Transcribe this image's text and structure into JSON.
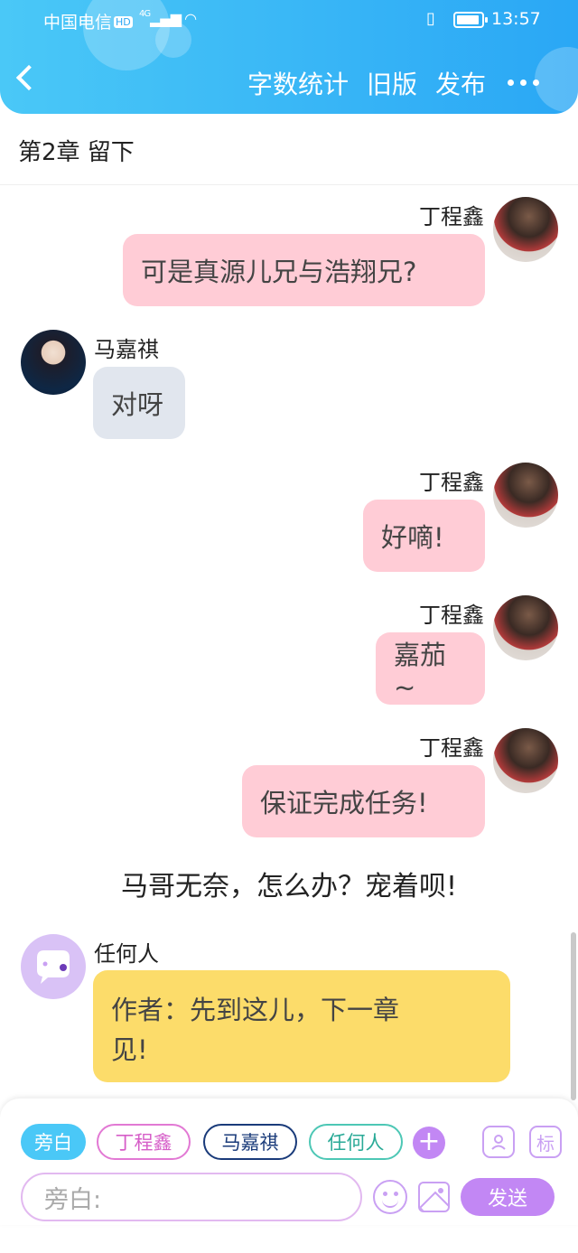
{
  "status_bar": {
    "carrier": "中国电信",
    "hd": "HD",
    "network": "4G",
    "time": "13:57"
  },
  "header": {
    "actions": [
      "字数统计",
      "旧版",
      "发布"
    ]
  },
  "chapter_title": "第2章 留下",
  "messages": [
    {
      "speaker": "丁程鑫",
      "text": "可是真源儿兄与浩翔兄?"
    },
    {
      "speaker": "马嘉祺",
      "text": "对呀"
    },
    {
      "speaker": "丁程鑫",
      "text": "好嘀!"
    },
    {
      "speaker": "丁程鑫",
      "text": "嘉茄~"
    },
    {
      "speaker": "丁程鑫",
      "text": "保证完成任务!"
    }
  ],
  "narration": "马哥无奈，怎么办？宠着呗!",
  "last_message": {
    "speaker": "任何人",
    "line1": "作者：先到这儿，下一章",
    "line2": "见!"
  },
  "composer": {
    "roles": [
      "旁白",
      "丁程鑫",
      "马嘉祺",
      "任何人"
    ],
    "add": "+",
    "tag_icon": "标",
    "placeholder": "旁白:",
    "send": "发送"
  },
  "colors": {
    "header": "#2aa7f5",
    "pink_bubble": "#ffccd6",
    "gray_bubble": "#e1e6ee",
    "yellow_bubble": "#fcdc6a",
    "accent": "#c287f4"
  }
}
